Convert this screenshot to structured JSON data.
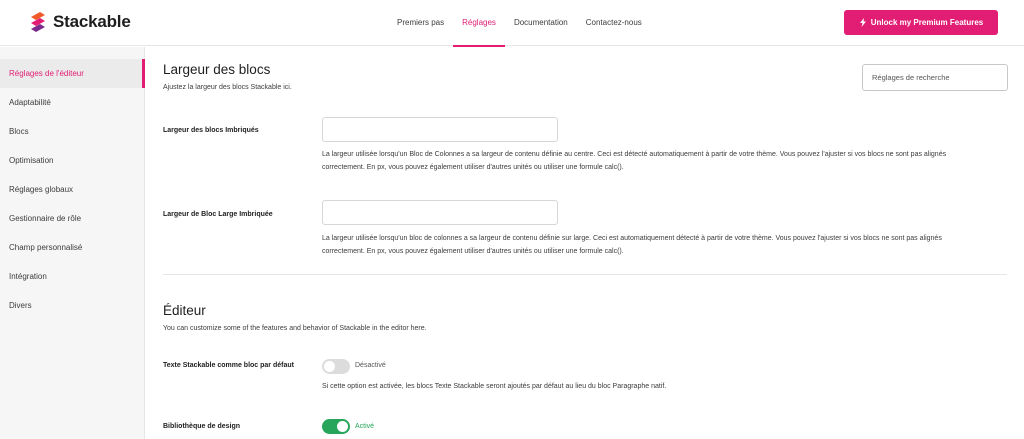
{
  "app": {
    "name": "Stackable"
  },
  "topnav": {
    "items": [
      {
        "label": "Premiers pas"
      },
      {
        "label": "Réglages"
      },
      {
        "label": "Documentation"
      },
      {
        "label": "Contactez-nous"
      }
    ],
    "active_index": 1
  },
  "premium_button": {
    "label": "Unlock my Premium Features"
  },
  "sidebar": {
    "items": [
      {
        "label": "Réglages de l'éditeur"
      },
      {
        "label": "Adaptabilité"
      },
      {
        "label": "Blocs"
      },
      {
        "label": "Optimisation"
      },
      {
        "label": "Réglages globaux"
      },
      {
        "label": "Gestionnaire de rôle"
      },
      {
        "label": "Champ personnalisé"
      },
      {
        "label": "Intégration"
      },
      {
        "label": "Divers"
      }
    ],
    "active_index": 0
  },
  "search": {
    "placeholder": "Réglages de recherche"
  },
  "sections": {
    "block_width": {
      "title": "Largeur des blocs",
      "subtitle": "Ajustez la largeur des blocs Stackable ici.",
      "fields": [
        {
          "label": "Largeur des blocs Imbriqués",
          "value": "",
          "help_line1": "La largeur utilisée lorsqu'un Bloc de Colonnes a sa largeur de contenu définie au centre. Ceci est détecté automatiquement à partir de votre thème. Vous pouvez l'ajuster si vos blocs ne sont pas alignés",
          "help_line2": "correctement. En px, vous pouvez également utiliser d'autres unités ou utiliser une formule calc()."
        },
        {
          "label": "Largeur de Bloc Large Imbriquée",
          "value": "",
          "help_line1": "La largeur utilisée lorsqu'un bloc de colonnes a sa largeur de contenu définie sur large. Ceci est automatiquement détecté à partir de votre thème. Vous pouvez l'ajuster si vos blocs ne sont pas alignés",
          "help_line2": "correctement. En px, vous pouvez également utiliser d'autres unités ou utiliser une formule calc()."
        }
      ]
    },
    "editor": {
      "title": "Éditeur",
      "subtitle": "You can customize some of the features and behavior of Stackable in the editor here.",
      "toggles": [
        {
          "label": "Texte Stackable comme bloc par défaut",
          "on": false,
          "state_label": "Désactivé",
          "help": "Si cette option est activée, les blocs Texte Stackable seront ajoutés par défaut au lieu du bloc Paragraphe natif."
        },
        {
          "label": "Bibliothèque de design",
          "on": true,
          "state_label": "Activé",
          "help": ""
        }
      ]
    }
  },
  "colors": {
    "accent": "#e11d74",
    "success": "#27a55a"
  }
}
